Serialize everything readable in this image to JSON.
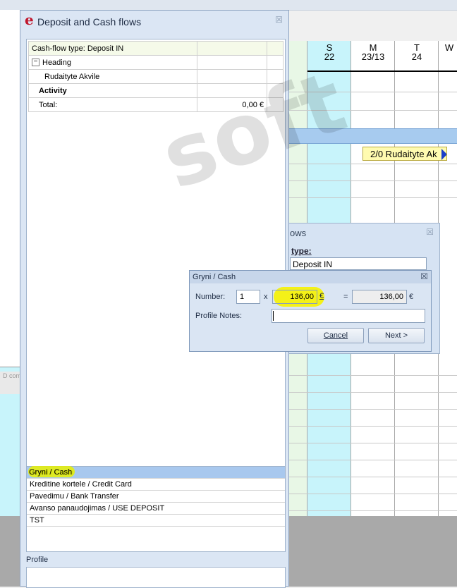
{
  "scheduler": {
    "days": [
      {
        "dow": "S",
        "date": "22"
      },
      {
        "dow": "M",
        "date": "23/13"
      },
      {
        "dow": "T",
        "date": "24"
      },
      {
        "dow": "W",
        "date": ""
      }
    ],
    "booking_label": "2/0 Rudaityte Ak"
  },
  "bg_dialog": {
    "title_fragment": "ows",
    "type_label": "type:",
    "type_value": "Deposit IN"
  },
  "main_dialog": {
    "logo": "e",
    "title": "Deposit and Cash flows",
    "close": "☒",
    "summary": {
      "type_row": "Cash-flow type: Deposit IN",
      "heading": "Heading",
      "guest": "Rudaityte Akvile",
      "activity": "Activity",
      "total_label": "Total:",
      "total_value": "0,00 €"
    },
    "payment_methods": [
      "Gryni / Cash",
      "Kreditine kortele / Credit Card",
      "Pavedimu / Bank Transfer",
      "Avanso panaudojimas / USE DEPOSIT",
      "TST"
    ],
    "profile_label": "Profile",
    "watermark": "soft"
  },
  "popup": {
    "title": "Gryni / Cash",
    "close": "☒",
    "number_label": "Number:",
    "number_value": "1",
    "times": "x",
    "amount_value": "136,00",
    "currency": "€",
    "equals": "=",
    "total_value": "136,00",
    "total_currency": "€",
    "notes_label": "Profile Notes:",
    "notes_value": "",
    "cancel_label": "Cancel",
    "next_label": "Next >"
  },
  "left_strip_text": "D com"
}
